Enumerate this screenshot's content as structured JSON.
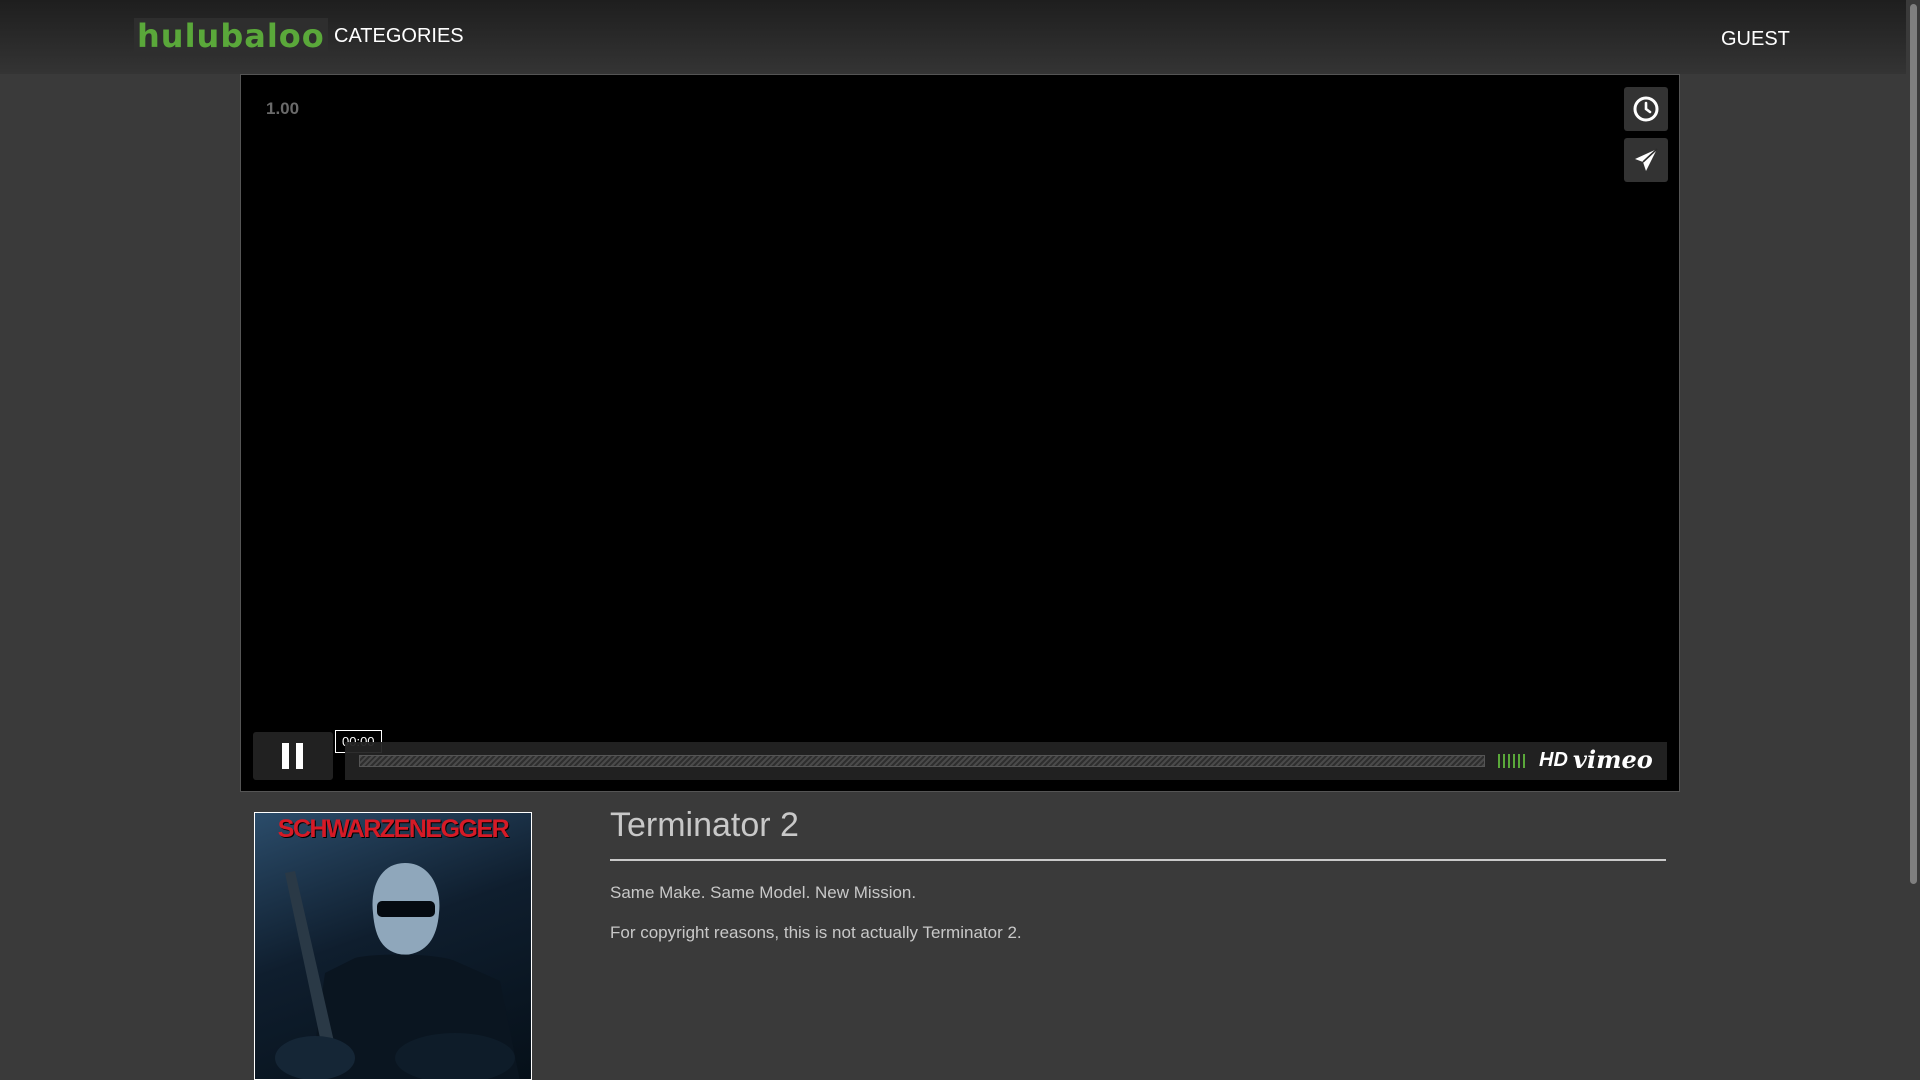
{
  "header": {
    "logo_text": "hulubaloo",
    "nav_categories": "CATEGORIES",
    "nav_user": "GUEST"
  },
  "player": {
    "speed": "1.00",
    "side_buttons": [
      "clock-icon",
      "send-icon"
    ],
    "pause_icon": "pause-icon",
    "time": "00:00",
    "progress": 0,
    "hd_label": "HD",
    "brand": "vimeo"
  },
  "movie": {
    "poster_name": "SCHWARZENEGGER",
    "title": "Terminator 2",
    "tagline": "Same Make. Same Model. New Mission.",
    "note": "For copyright reasons, this is not actually Terminator 2."
  },
  "colors": {
    "logo": "#5aa83a",
    "background": "#3a3a3a",
    "poster_title": "#d61a26"
  }
}
